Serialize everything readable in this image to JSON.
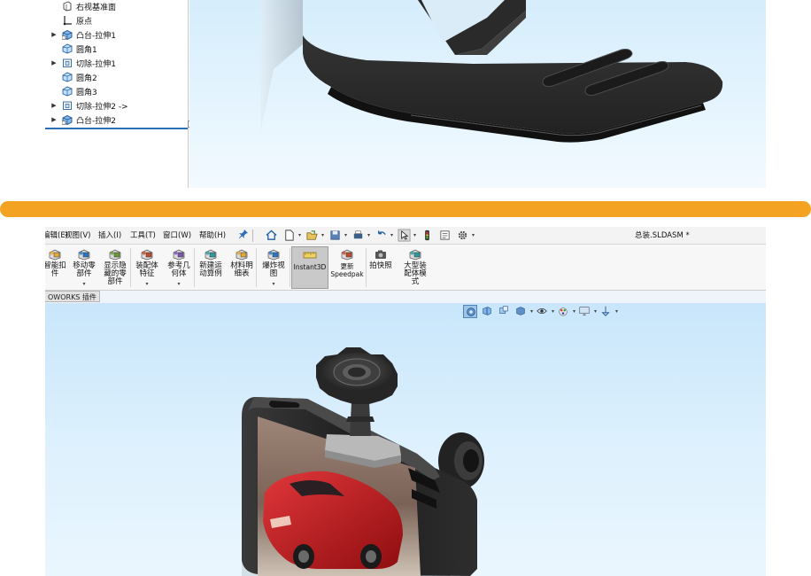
{
  "feature_tree": {
    "items": [
      {
        "label": "右视基准面",
        "icon": "plane-icon",
        "expandable": false
      },
      {
        "label": "原点",
        "icon": "origin-icon",
        "expandable": false
      },
      {
        "label": "凸台-拉伸1",
        "icon": "boss-extrude-icon",
        "expandable": true
      },
      {
        "label": "圆角1",
        "icon": "fillet-icon",
        "expandable": false
      },
      {
        "label": "切除-拉伸1",
        "icon": "cut-extrude-icon",
        "expandable": true
      },
      {
        "label": "圆角2",
        "icon": "fillet-icon",
        "expandable": false
      },
      {
        "label": "圆角3",
        "icon": "fillet-icon",
        "expandable": false
      },
      {
        "label": "切除-拉伸2 ->",
        "icon": "cut-extrude-icon",
        "expandable": true
      },
      {
        "label": "凸台-拉伸2",
        "icon": "boss-extrude-icon",
        "expandable": true
      }
    ]
  },
  "menubar": {
    "items": [
      "编辑(E)",
      "视图(V)",
      "插入(I)",
      "工具(T)",
      "窗口(W)",
      "帮助(H)"
    ],
    "pin_icon": "pin-icon",
    "document_title": "总装.SLDASM *"
  },
  "quick_access": [
    {
      "icon": "home-icon",
      "caret": false
    },
    {
      "icon": "new-document-icon",
      "caret": true
    },
    {
      "icon": "open-folder-icon",
      "caret": true
    },
    {
      "icon": "save-icon",
      "caret": true
    },
    {
      "icon": "print-icon",
      "caret": true
    },
    {
      "icon": "undo-icon",
      "caret": true
    },
    {
      "icon": "select-arrow-icon",
      "caret": true
    },
    {
      "icon": "traffic-light-icon",
      "caret": false
    },
    {
      "icon": "file-properties-icon",
      "caret": false
    },
    {
      "icon": "gear-icon",
      "caret": true
    }
  ],
  "ribbon": {
    "buttons": [
      {
        "label": "智能扣\n件",
        "icon": "smart-fastener-icon",
        "caret": false
      },
      {
        "label": "移动零\n部件",
        "icon": "move-component-icon",
        "caret": true
      },
      {
        "label": "显示隐\n藏的零\n部件",
        "icon": "show-hidden-icon",
        "caret": false
      },
      {
        "label": "装配体\n特征",
        "icon": "assembly-feature-icon",
        "caret": true
      },
      {
        "label": "参考几\n何体",
        "icon": "reference-geometry-icon",
        "caret": true
      },
      {
        "label": "新建运\n动算例",
        "icon": "motion-study-icon",
        "caret": false
      },
      {
        "label": "材料明\n细表",
        "icon": "bom-icon",
        "caret": false
      },
      {
        "label": "爆炸视\n图",
        "icon": "exploded-view-icon",
        "caret": true
      },
      {
        "label": "Instant3D",
        "icon": "instant3d-icon",
        "caret": false,
        "active": true
      },
      {
        "label": "更新\nSpeedpak",
        "icon": "speedpak-icon",
        "caret": false
      },
      {
        "label": "拍快照",
        "icon": "snapshot-icon",
        "caret": false
      },
      {
        "label": "大型装\n配体模\n式",
        "icon": "large-assembly-icon",
        "caret": false
      }
    ]
  },
  "tabs": {
    "addins_label": "OWORKS 插件"
  },
  "view_toolbar": [
    {
      "icon": "view-orientation-icon",
      "active": true
    },
    {
      "icon": "section-view-icon"
    },
    {
      "icon": "zoom-to-fit-icon"
    },
    {
      "icon": "display-style-icon",
      "caret": true
    },
    {
      "icon": "hide-show-items-icon",
      "caret": true
    },
    {
      "icon": "appearance-icon",
      "caret": true
    },
    {
      "icon": "scene-icon",
      "caret": true
    },
    {
      "icon": "view-settings-icon",
      "caret": true
    }
  ],
  "colors": {
    "divider": "#f4a221",
    "viewport_top": "#d5edfc",
    "viewport_bottom": "#c9e6fb",
    "selection_blue": "#2c6fb5",
    "model_dark": "#2b2b2b",
    "car_red": "#c8171b"
  }
}
